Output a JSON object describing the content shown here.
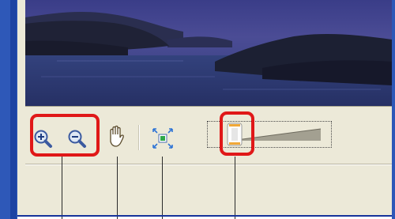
{
  "toolbar": {
    "buttons": [
      {
        "name": "zoom-in",
        "icon": "zoom-in-icon"
      },
      {
        "name": "zoom-out",
        "icon": "zoom-out-icon"
      },
      {
        "name": "pan",
        "icon": "hand-icon"
      },
      {
        "name": "fit-to-window",
        "icon": "fit-to-window-icon"
      }
    ],
    "zoom_slider": {
      "value_fraction": 0.22
    }
  },
  "callouts": {
    "highlight_color": "#e01818",
    "leader_color": "#2a2a2a"
  },
  "colors": {
    "panel": "#ece9d8",
    "window_frame": "#2e58b8",
    "photo_sky": "#4a4a92",
    "photo_water": "#2c3770"
  }
}
